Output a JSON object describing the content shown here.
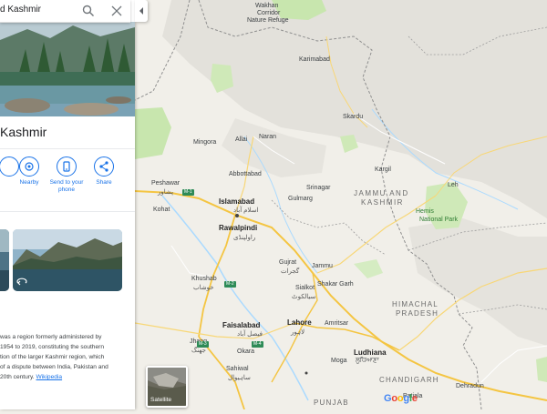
{
  "search": {
    "query": "d Kashmir"
  },
  "place": {
    "title": "Kashmir",
    "actions": [
      {
        "label": "Nearby"
      },
      {
        "label": "Send to your phone"
      },
      {
        "label": "Share"
      }
    ],
    "description_lines": [
      "was a region formerly administered by",
      "1954 to 2019, constituting the southern",
      "tion of the larger Kashmir region, which",
      "of a dispute between India, Pakistan and",
      "20th century."
    ],
    "wiki_link": "Wikipedia"
  },
  "map": {
    "labels": {
      "wakhan": "Wakhan",
      "corridor": "Corridor",
      "nature_refuge": "Nature Refuge",
      "karimabad": "Karimabad",
      "skardu": "Skardu",
      "mingora": "Mingora",
      "naran": "Naran",
      "allai": "Allai",
      "peshawar": "Peshawar",
      "peshawar_ur": "پشاور",
      "abbottabad": "Abbottabad",
      "srinagar": "Srinagar",
      "gulmarg": "Gulmarg",
      "kargil": "Kargil",
      "leh": "Leh",
      "jk_line1": "JAMMU AND",
      "jk_line2": "KASHMIR",
      "hemis_line1": "Hemis",
      "hemis_line2": "National Park",
      "kohat": "Kohat",
      "islamabad": "Islamabad",
      "islamabad_ur": "اسلام آباد",
      "rawalpindi": "Rawalpindi",
      "rawalpindi_ur": "راولپنڈی",
      "gujrat": "Gujrat",
      "gujrat_ur": "گجرات",
      "jammu": "Jammu",
      "khushab": "Khushab",
      "khushab_ur": "خوشاب",
      "sialkot": "Sialkot",
      "sialkot_ur": "سیالکوٹ",
      "shakar_garh": "Shakar Garh",
      "hp_line1": "HIMACHAL",
      "hp_line2": "PRADESH",
      "faisalabad": "Faisalabad",
      "faisalabad_ur": "فیصل آباد",
      "lahore": "Lahore",
      "lahore_ur": "لاہور",
      "amritsar": "Amritsar",
      "ludhiana": "Ludhiana",
      "ludhiana_pa": "ਲੁਧਿਆਣਾ",
      "jhang": "Jhang",
      "jhang_ur": "جھنگ",
      "okara": "Okara",
      "sahiwal": "Sahiwal",
      "sahiwal_ur": "ساہیوال",
      "moga": "Moga",
      "punjab": "PUNJAB",
      "patiala": "Patiala",
      "chandigarh": "CHANDIGARH",
      "dehradun": "Dehradun"
    },
    "highways": {
      "m1": "M-1",
      "m2": "M-2",
      "m3": "M-3",
      "m4": "M-4"
    }
  },
  "satellite_label": "Satellite",
  "brand": {
    "chars": [
      "G",
      "o",
      "o",
      "g",
      "l",
      "e"
    ],
    "colors": [
      "#4285F4",
      "#EA4335",
      "#FBBC05",
      "#4285F4",
      "#34A853",
      "#EA4335"
    ]
  },
  "colors": {
    "accent": "#1a73e8",
    "land": "#f1efe9",
    "mountain": "#e2e0da",
    "forest": "#c9e8b2",
    "border": "#9e9e9e",
    "highway": "#f4c542"
  }
}
